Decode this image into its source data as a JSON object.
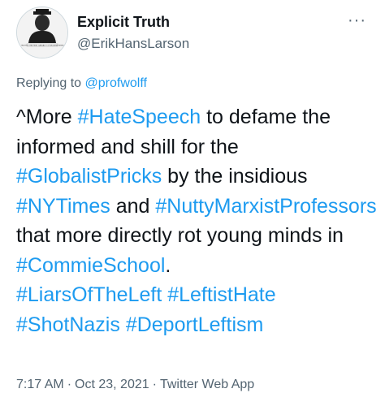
{
  "author": {
    "name": "Explicit Truth",
    "handle": "@ErikHansLarson",
    "avatar_icon": "portrait-photo-icon",
    "avatar_caption": "TRUTH IS THE FIRST CASUALTY OF MODERN VIEWS"
  },
  "more_icon": "···",
  "reply": {
    "prefix": "Replying to ",
    "mention": "@profwolff"
  },
  "tweet": {
    "t1": "^More ",
    "h1": "#HateSpeech",
    "t2": " to defame the informed and shill for the ",
    "h2": "#GlobalistPricks",
    "t3": " by the insidious ",
    "h3": "#NYTimes",
    "t4": " and ",
    "h4": "#NuttyMarxistProfessors",
    "t5": " that more directly rot young minds in ",
    "h5": "#CommieSchool",
    "t6": ". ",
    "h6": "#LiarsOfTheLeft",
    "t7": " ",
    "h7": "#LeftistHate",
    "t8": " ",
    "h8": "#ShotNazis",
    "t9": " ",
    "h9": "#DeportLeftism"
  },
  "meta": {
    "time": "7:17 AM",
    "separator": "·",
    "date": "Oct 23, 2021",
    "source": "Twitter Web App"
  },
  "colors": {
    "link": "#1d9bf0",
    "text": "#0f1419",
    "secondary": "#536471"
  }
}
